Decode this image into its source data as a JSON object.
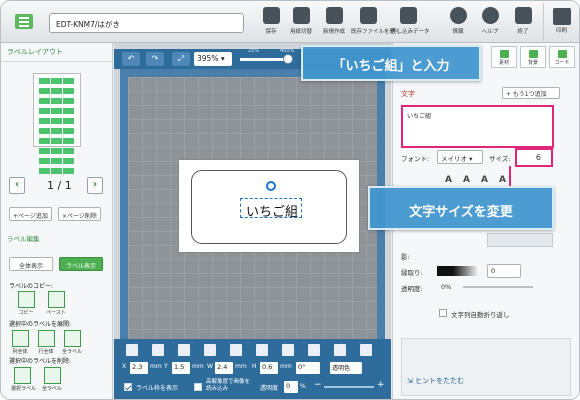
{
  "toolbar": {
    "filename": "EDT-KNM7/はがき",
    "items": [
      {
        "label": "保存",
        "icon": "save-icon"
      },
      {
        "label": "用紙切替",
        "icon": "paper-switch-icon"
      },
      {
        "label": "新規作成",
        "icon": "new-icon"
      },
      {
        "label": "既存ファイルを開く",
        "icon": "open-file-icon"
      },
      {
        "label": "差し込みデータ",
        "icon": "merge-data-icon"
      },
      {
        "label": "情報",
        "icon": "info-icon"
      },
      {
        "label": "ヘルプ",
        "icon": "help-icon"
      },
      {
        "label": "終了",
        "icon": "exit-icon"
      }
    ],
    "print_label": "印刷"
  },
  "left_panel": {
    "layout_title": "ラベルレイアウト",
    "page_text": "1 / 1",
    "add_page": "+ページ追加",
    "delete_page": "×ページ削除",
    "edit_title": "ラベル編集",
    "view_all": "全体表示",
    "view_label": "ラベル表示",
    "copy_title": "ラベルのコピー:",
    "copy_btn": "コピー",
    "paste_btn": "ペースト",
    "expand_title": "選択中のラベルを展開:",
    "expand": [
      "列全体",
      "行全体",
      "全ラベル"
    ],
    "delete_title": "選択中のラベルを削除:",
    "delete": [
      "選択ラベル",
      "全ラベル"
    ]
  },
  "canvas": {
    "zoom": "395%",
    "zoom_min_label": "25%",
    "zoom_max_label": "400%",
    "zoom_fraction": 0.93,
    "label_text": "いちご組"
  },
  "bottom_bar": {
    "x_label": "X",
    "x_value": "2.3",
    "x_unit": "mm",
    "y_label": "Y",
    "y_value": "1.5",
    "y_unit": "mm",
    "w_label": "W",
    "w_value": "2.4",
    "w_unit": "mm",
    "h_label": "H",
    "h_value": "0.6",
    "h_unit": "mm",
    "angle": "0°",
    "transparent_color": "透明色",
    "show_frame": "ラベル枠を表示",
    "high_res": "高解像度で画像を読み込み",
    "opacity_label": "透明度",
    "opacity_value": "0",
    "opacity_unit": "%"
  },
  "right_panel": {
    "tabs": [
      "素材",
      "背景",
      "コード"
    ],
    "section_title": "文字",
    "add_line": "+ もう1つ追加",
    "text_value": "いちご組",
    "font_label": "フォント:",
    "font_value": "メイリオ",
    "size_label": "サイズ:",
    "size_value": "6",
    "shadow_label": "影:",
    "outline_label": "縁取り:",
    "outline_value": "0",
    "opacity_label": "透明度:",
    "opacity_value": "0%",
    "auto_wrap": "文字列自動折り返し",
    "hide_hint": "ヒントをたたむ"
  },
  "callouts": {
    "input": "「いちご組」と入力",
    "size": "文字サイズを変更"
  }
}
